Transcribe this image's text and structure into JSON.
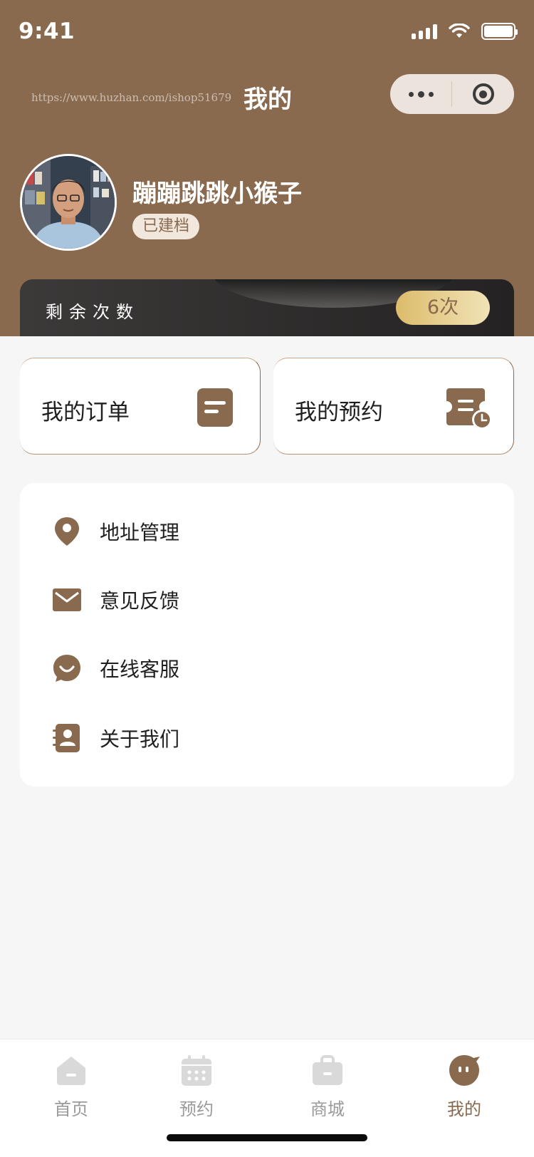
{
  "status_bar": {
    "time": "9:41"
  },
  "header": {
    "url_watermark": "https://www.huzhan.com/ishop51679",
    "title": "我的",
    "brand_color": "#8a6a4f"
  },
  "profile": {
    "name": "蹦蹦跳跳小猴子",
    "badge": "已建档"
  },
  "remaining": {
    "label": "剩余次数",
    "value": "6次"
  },
  "quick_actions": [
    {
      "label": "我的订单",
      "icon": "order-list-icon"
    },
    {
      "label": "我的预约",
      "icon": "appointment-ticket-icon"
    }
  ],
  "menu": [
    {
      "label": "地址管理",
      "icon": "location-pin-icon"
    },
    {
      "label": "意见反馈",
      "icon": "mail-icon"
    },
    {
      "label": "在线客服",
      "icon": "smile-chat-icon"
    },
    {
      "label": "关于我们",
      "icon": "contact-book-icon"
    }
  ],
  "tabs": [
    {
      "label": "首页",
      "icon": "home-icon",
      "active": false
    },
    {
      "label": "预约",
      "icon": "calendar-icon",
      "active": false
    },
    {
      "label": "商城",
      "icon": "bag-icon",
      "active": false
    },
    {
      "label": "我的",
      "icon": "profile-face-icon",
      "active": true
    }
  ],
  "colors": {
    "accent": "#8a6a4f",
    "tab_inactive": "#9a9a9a",
    "gold": "#dcbc6c"
  }
}
